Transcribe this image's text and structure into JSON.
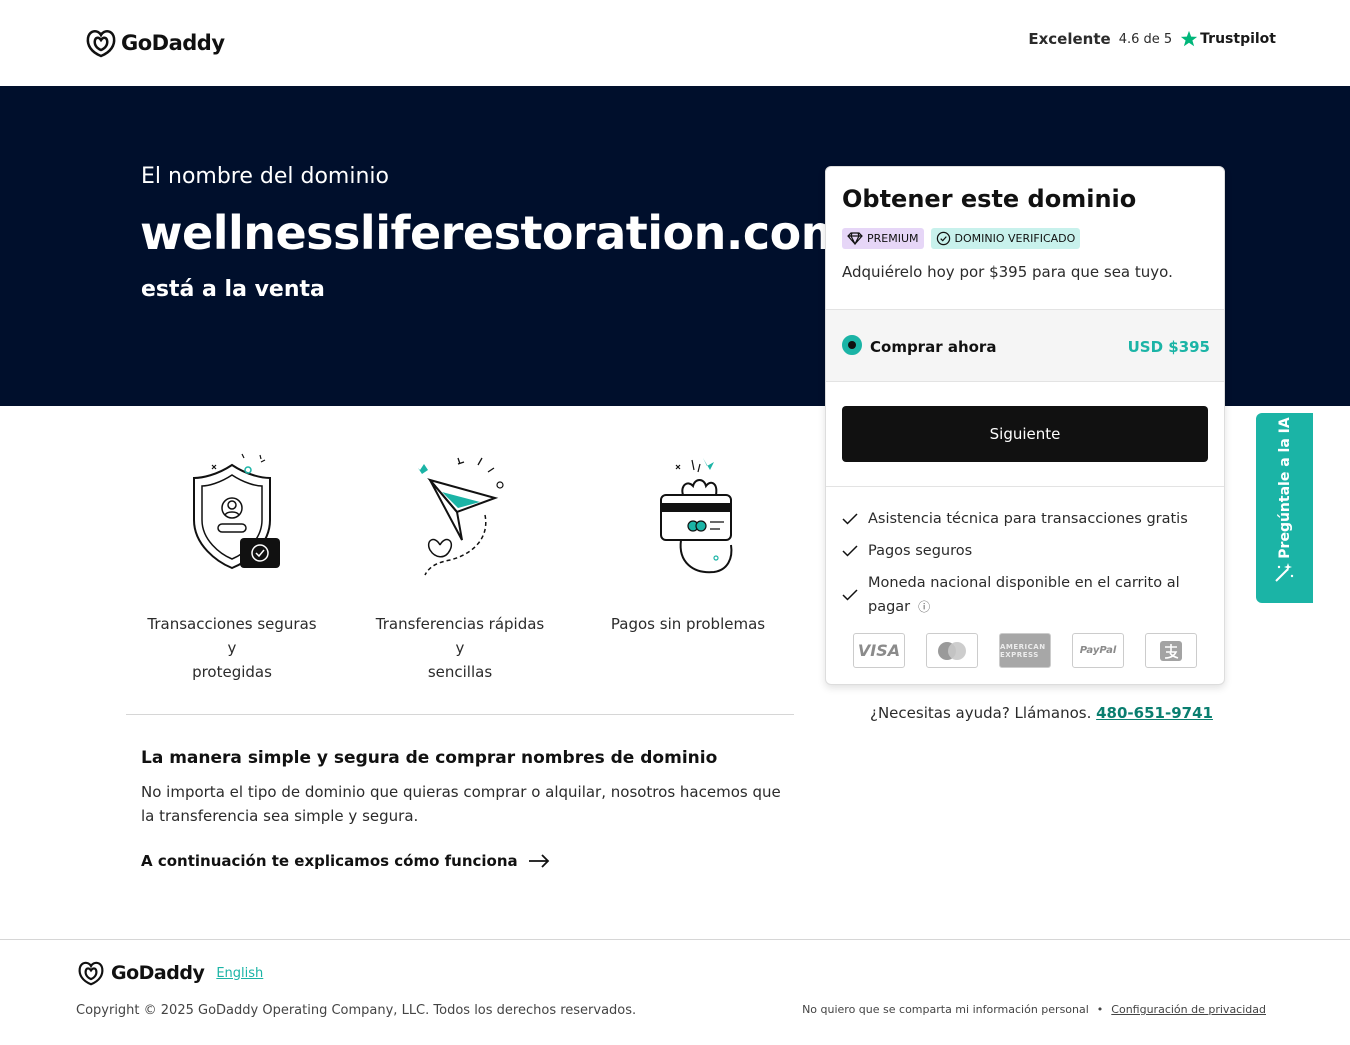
{
  "header": {
    "brand": "GoDaddy",
    "rating_label": "Excelente",
    "rating_score": "4.6 de 5",
    "trustpilot": "Trustpilot"
  },
  "hero": {
    "subtitle": "El nombre del dominio",
    "domain": "wellnessliferestoration.com",
    "sale_text": "está a la venta"
  },
  "card": {
    "title": "Obtener este dominio",
    "badge_premium": "PREMIUM",
    "badge_verified": "DOMINIO VERIFICADO",
    "description": "Adquiérelo hoy por $395 para que sea tuyo.",
    "buy_label": "Comprar ahora",
    "buy_price": "USD $395",
    "next_button": "Siguiente",
    "features": [
      "Asistencia técnica para transacciones gratis",
      "Pagos seguros",
      "Moneda nacional disponible en el carrito al pagar"
    ],
    "payments": [
      "VISA",
      "",
      "AMERICAN EXPRESS",
      "PayPal",
      ""
    ]
  },
  "help": {
    "text": "¿Necesitas ayuda? Llámanos.",
    "phone": "480-651-9741"
  },
  "ai_tab": {
    "label": "Pregúntale a la IA"
  },
  "benefits": [
    {
      "line1": "Transacciones seguras y",
      "line2": "protegidas"
    },
    {
      "line1": "Transferencias rápidas y",
      "line2": "sencillas"
    },
    {
      "line1": "Pagos sin problemas",
      "line2": ""
    }
  ],
  "info": {
    "title": "La manera simple y segura de comprar nombres de dominio",
    "description": "No importa el tipo de dominio que quieras comprar o alquilar, nosotros hacemos que la transferencia sea simple y segura.",
    "link": "A continuación te explicamos cómo funciona"
  },
  "footer": {
    "brand": "GoDaddy",
    "language": "English",
    "copyright": "Copyright © 2025 GoDaddy Operating Company, LLC. Todos los derechos reservados.",
    "no_share": "No quiero que se comparta mi información personal",
    "privacy": "Configuración de privacidad"
  },
  "colors": {
    "hero_bg": "#000f2c",
    "accent": "#1bb4a6",
    "button": "#111111"
  }
}
